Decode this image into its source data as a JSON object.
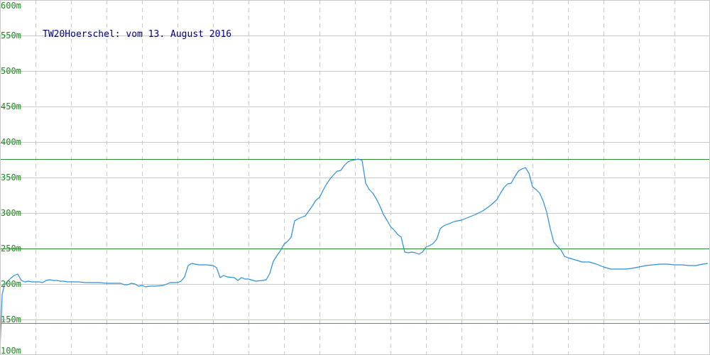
{
  "chart_data": {
    "type": "line",
    "title": "TW20Hoerschel: vom 13. August 2016",
    "xlabel": "",
    "ylabel": "",
    "ylim": [
      100,
      600
    ],
    "yticks": [
      600,
      550,
      500,
      450,
      400,
      350,
      300,
      250,
      200,
      150,
      100
    ],
    "ytick_labels": [
      "600m",
      "550m",
      "500m",
      "450m",
      "400m",
      "350m",
      "300m",
      "250m",
      "200m",
      "150m",
      "100m"
    ],
    "xlim": [
      0,
      1000
    ],
    "x_gridlines": [
      50,
      100,
      150,
      200,
      250,
      300,
      350,
      400,
      450,
      500,
      550,
      600,
      650,
      700,
      750,
      800,
      850,
      900,
      950,
      1000
    ],
    "grid": true,
    "reference_lines": [
      {
        "value": 376,
        "color": "#2e8b2e"
      },
      {
        "value": 250,
        "color": "#2e8b2e"
      },
      {
        "value": 145,
        "color": "#20a0c0"
      }
    ],
    "line_color": "#2a8fd8",
    "series": [
      {
        "x": [
          0,
          3,
          6,
          10,
          15,
          20,
          25,
          30,
          35,
          40,
          45,
          50,
          55,
          60,
          65,
          70,
          75,
          80,
          85,
          90,
          95,
          100,
          110,
          120,
          130,
          140,
          150,
          160,
          170,
          175,
          180,
          185,
          190,
          195,
          200,
          205,
          210,
          220,
          230,
          240,
          250,
          255,
          260,
          265,
          270,
          280,
          290,
          300,
          305,
          310,
          315,
          320,
          330,
          335,
          340,
          345,
          350,
          360,
          370,
          375,
          380,
          385,
          390,
          395,
          400,
          405,
          410,
          415,
          420,
          425,
          430,
          440,
          445,
          450,
          455,
          460,
          465,
          470,
          475,
          480,
          485,
          490,
          495,
          500,
          505,
          510,
          515,
          520,
          525,
          530,
          535,
          540,
          545,
          550,
          555,
          560,
          565,
          570,
          575,
          580,
          585,
          590,
          595,
          600,
          605,
          610,
          615,
          620,
          625,
          630,
          640,
          650,
          660,
          670,
          680,
          690,
          700,
          705,
          710,
          715,
          720,
          725,
          730,
          735,
          740,
          745,
          750,
          755,
          760,
          765,
          770,
          775,
          780,
          785,
          790,
          795,
          800,
          810,
          820,
          830,
          840,
          850,
          860,
          870,
          880,
          890,
          900,
          910,
          920,
          930,
          940,
          950,
          960,
          970,
          980,
          990,
          997
        ],
        "y": [
          106,
          185,
          198,
          203,
          208,
          212,
          214,
          205,
          203,
          204,
          203,
          203,
          203,
          202,
          205,
          206,
          205,
          205,
          204,
          204,
          203,
          203,
          203,
          202,
          202,
          202,
          201,
          201,
          201,
          199,
          199,
          201,
          200,
          197,
          198,
          196,
          197,
          197,
          198,
          202,
          202,
          204,
          210,
          226,
          229,
          227,
          227,
          226,
          223,
          209,
          212,
          210,
          209,
          205,
          209,
          207,
          207,
          204,
          205,
          206,
          215,
          232,
          240,
          247,
          256,
          260,
          266,
          289,
          292,
          294,
          296,
          310,
          318,
          322,
          332,
          341,
          348,
          354,
          359,
          360,
          367,
          372,
          374,
          375,
          376,
          374,
          342,
          333,
          328,
          320,
          310,
          298,
          290,
          281,
          276,
          270,
          266,
          245,
          244,
          245,
          244,
          242,
          245,
          252,
          254,
          257,
          263,
          278,
          282,
          284,
          288,
          290,
          294,
          298,
          303,
          310,
          319,
          328,
          336,
          341,
          342,
          351,
          359,
          362,
          364,
          356,
          337,
          333,
          328,
          317,
          301,
          278,
          259,
          253,
          248,
          239,
          237,
          234,
          231,
          231,
          228,
          224,
          221,
          221,
          221,
          222,
          224,
          226,
          227,
          228,
          228,
          227,
          227,
          226,
          226,
          228,
          229
        ]
      }
    ]
  }
}
